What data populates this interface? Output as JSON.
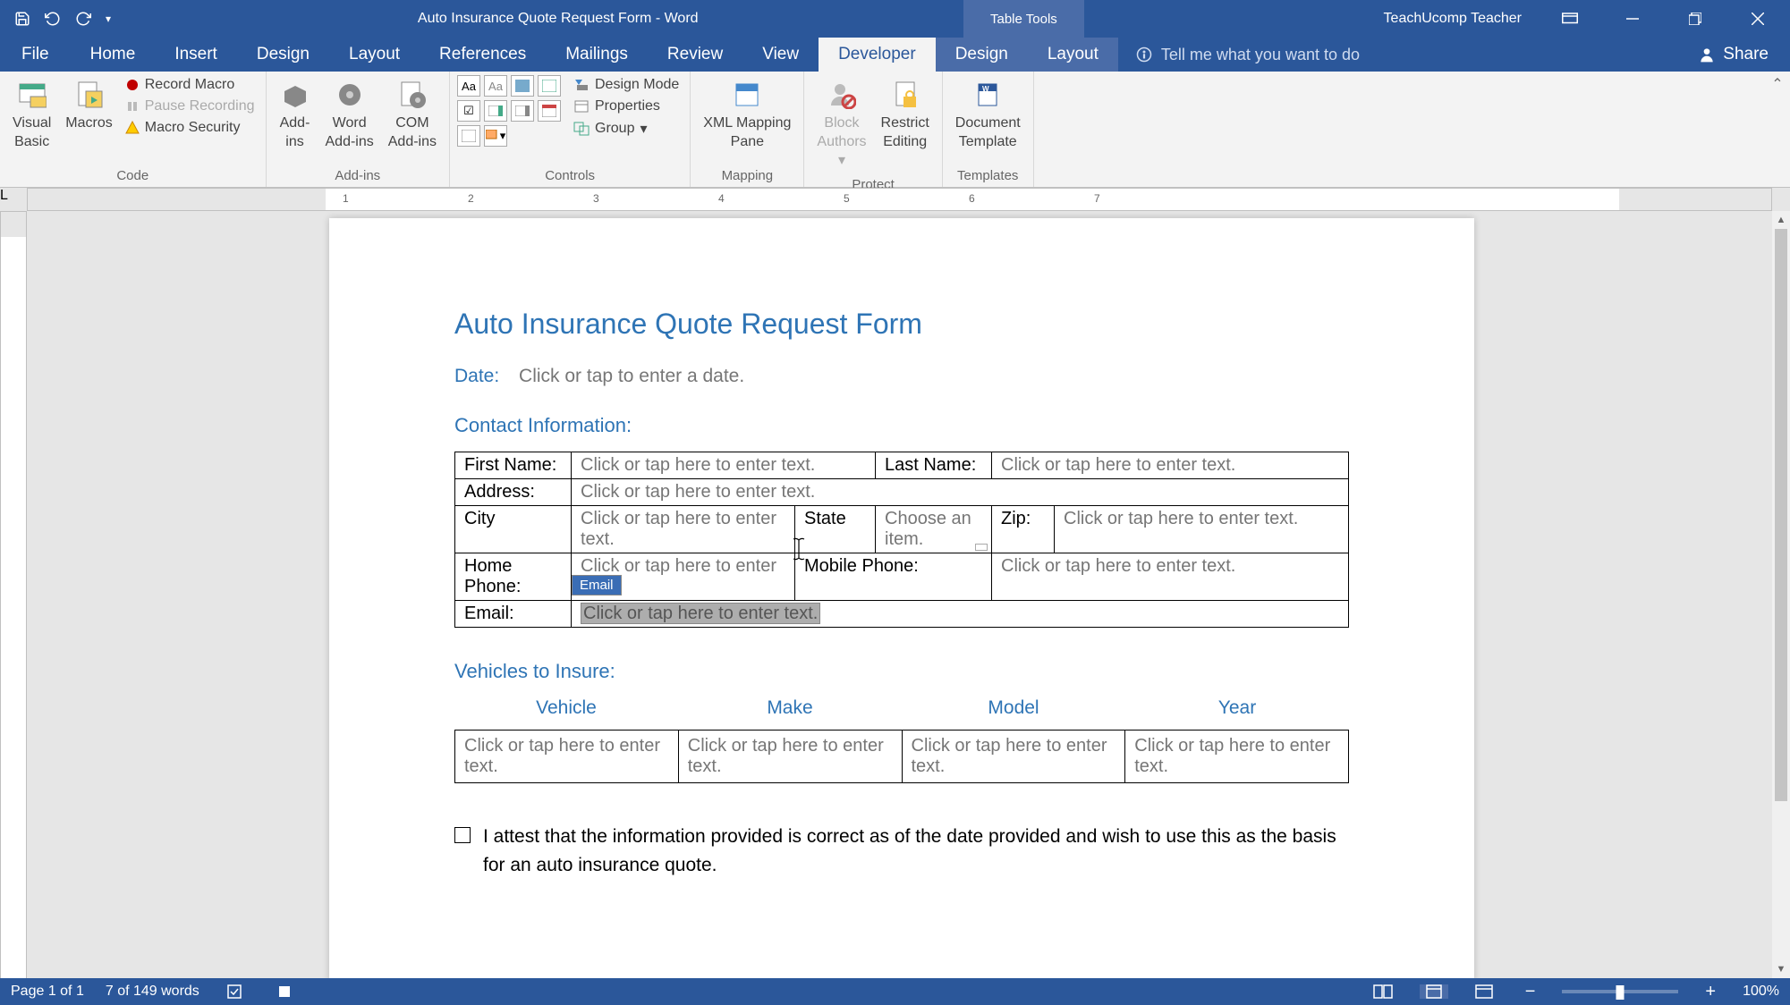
{
  "titlebar": {
    "title": "Auto Insurance Quote Request Form - Word",
    "table_tools": "Table Tools",
    "user": "TeachUcomp Teacher"
  },
  "tabs": {
    "file": "File",
    "home": "Home",
    "insert": "Insert",
    "design": "Design",
    "layout": "Layout",
    "references": "References",
    "mailings": "Mailings",
    "review": "Review",
    "view": "View",
    "developer": "Developer",
    "table_design": "Design",
    "table_layout": "Layout",
    "tellme": "Tell me what you want to do",
    "share": "Share"
  },
  "ribbon": {
    "code": {
      "visual_basic": "Visual\nBasic",
      "macros": "Macros",
      "record_macro": "Record Macro",
      "pause_recording": "Pause Recording",
      "macro_security": "Macro Security",
      "label": "Code"
    },
    "addins": {
      "addins": "Add-\nins",
      "word_addins": "Word\nAdd-ins",
      "com_addins": "COM\nAdd-ins",
      "label": "Add-ins"
    },
    "controls": {
      "design_mode": "Design Mode",
      "properties": "Properties",
      "group": "Group",
      "label": "Controls"
    },
    "mapping": {
      "xml_mapping": "XML Mapping\nPane",
      "label": "Mapping"
    },
    "protect": {
      "block_authors": "Block\nAuthors",
      "restrict_editing": "Restrict\nEditing",
      "label": "Protect"
    },
    "templates": {
      "doc_template": "Document\nTemplate",
      "label": "Templates"
    }
  },
  "doc": {
    "title": "Auto Insurance Quote Request Form",
    "date_label": "Date:",
    "date_placeholder": "Click or tap to enter a date.",
    "contact_heading": "Contact Information:",
    "labels": {
      "first_name": "First Name:",
      "last_name": "Last Name:",
      "address": "Address:",
      "city": "City",
      "state": "State",
      "state_placeholder": "Choose an item.",
      "zip": "Zip:",
      "home_phone": "Home Phone:",
      "mobile_phone": "Mobile Phone:",
      "email": "Email:"
    },
    "placeholder": "Click or tap here to enter text.",
    "email_tag": "Email",
    "vehicles_heading": "Vehicles to Insure:",
    "vehicle_cols": {
      "vehicle": "Vehicle",
      "make": "Make",
      "model": "Model",
      "year": "Year"
    },
    "attest": "I attest that the information provided is correct as of the date provided and wish to use this as the basis for an auto insurance quote."
  },
  "statusbar": {
    "page": "Page 1 of 1",
    "words": "7 of 149 words",
    "zoom": "100%"
  }
}
